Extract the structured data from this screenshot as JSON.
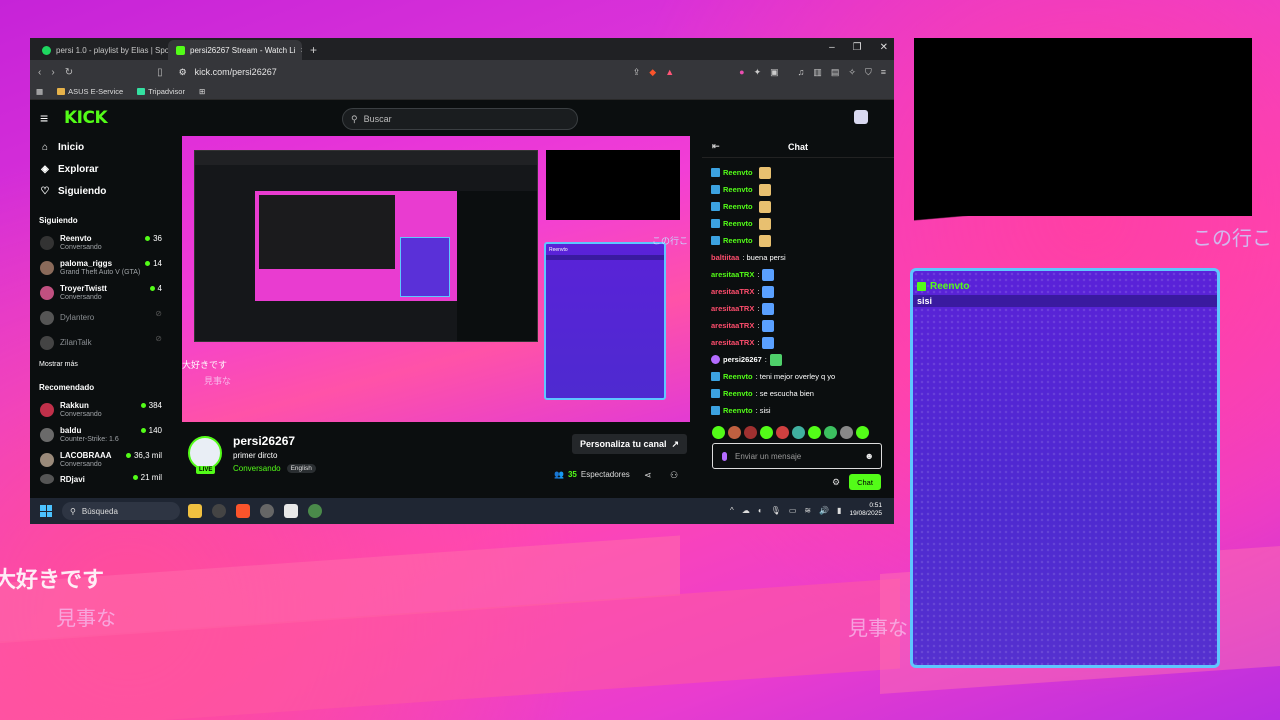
{
  "browser": {
    "tabs": [
      {
        "label": "persi 1.0 - playlist by Elias | Spotify",
        "favicon_color": "#1ed760"
      },
      {
        "label": "persi26267 Stream - Watch Li",
        "favicon_color": "#53fc18"
      }
    ],
    "new_tab": "+",
    "url": "kick.com/persi26267",
    "bookmarks": [
      "ASUS E-Service",
      "Tripadvisor"
    ]
  },
  "kick": {
    "logo": "KICK",
    "search_placeholder": "Buscar",
    "nav": [
      {
        "label": "Inicio",
        "icon": "home-icon"
      },
      {
        "label": "Explorar",
        "icon": "compass-icon"
      },
      {
        "label": "Siguiendo",
        "icon": "heart-icon"
      }
    ],
    "following_title": "Siguiendo",
    "following": [
      {
        "name": "Reenvto",
        "sub": "Conversando",
        "viewers": "36",
        "online": true
      },
      {
        "name": "paloma_riggs",
        "sub": "Grand Theft Auto V (GTA)",
        "viewers": "14",
        "online": true
      },
      {
        "name": "TroyerTwistt",
        "sub": "Conversando",
        "viewers": "4",
        "online": true
      },
      {
        "name": "Dylantero",
        "sub": "",
        "viewers": "",
        "online": false
      },
      {
        "name": "ZilanTalk",
        "sub": "",
        "viewers": "",
        "online": false
      }
    ],
    "show_more": "Mostrar más",
    "recommended_title": "Recomendado",
    "recommended": [
      {
        "name": "Rakkun",
        "sub": "Conversando",
        "viewers": "384"
      },
      {
        "name": "baldu",
        "sub": "Counter-Strike: 1.6",
        "viewers": "140"
      },
      {
        "name": "LACOBRAAA",
        "sub": "Conversando",
        "viewers": "36,3 mil"
      },
      {
        "name": "RDjavi",
        "sub": "",
        "viewers": "21 mil"
      }
    ],
    "stream": {
      "name": "persi26267",
      "title": "primer dircto",
      "category": "Conversando",
      "language": "English",
      "live_badge": "LIVE",
      "customize": "Personaliza tu canal",
      "viewers": "35",
      "viewers_label": "Espectadores"
    },
    "player_overlay": {
      "jp1": "大好きです",
      "jp2": "見事な",
      "jp3": "この行こ",
      "chat_user": "Reenvto"
    },
    "chat": {
      "title": "Chat",
      "messages": [
        {
          "user": "Reenvto",
          "color": "#53fc18",
          "text": "",
          "emote": true
        },
        {
          "user": "Reenvto",
          "color": "#53fc18",
          "text": "",
          "emote": true
        },
        {
          "user": "Reenvto",
          "color": "#53fc18",
          "text": "",
          "emote": true
        },
        {
          "user": "Reenvto",
          "color": "#53fc18",
          "text": "",
          "emote": true
        },
        {
          "user": "Reenvto",
          "color": "#53fc18",
          "text": "",
          "emote": true
        },
        {
          "user": "baltiitaa",
          "color": "#ff4d6d",
          "text": ": buena persi",
          "emote": false
        },
        {
          "user": "aresitaaTRX",
          "color": "#53fc18",
          "text": ":",
          "emote": true
        },
        {
          "user": "aresitaaTRX",
          "color": "#ff4d6d",
          "text": ":",
          "emote": true
        },
        {
          "user": "aresitaaTRX",
          "color": "#ff4d6d",
          "text": ":",
          "emote": true
        },
        {
          "user": "aresitaaTRX",
          "color": "#ff4d6d",
          "text": ":",
          "emote": true
        },
        {
          "user": "aresitaaTRX",
          "color": "#ff4d6d",
          "text": ":",
          "emote": true
        },
        {
          "user": "persi26267",
          "color": "#ffffff",
          "text": ":",
          "emote": true
        },
        {
          "user": "Reenvto",
          "color": "#53fc18",
          "text": ": teni mejor overley q yo",
          "emote": false
        },
        {
          "user": "Reenvto",
          "color": "#53fc18",
          "text": ": se escucha bien",
          "emote": false
        },
        {
          "user": "Reenvto",
          "color": "#53fc18",
          "text": ": sisi",
          "emote": false
        }
      ],
      "input_placeholder": "Enviar un mensaje",
      "send_label": "Chat"
    }
  },
  "taskbar": {
    "search": "Búsqueda",
    "time": "0:51",
    "date": "19/08/2025"
  },
  "overlay": {
    "chat_user": "Reenvto",
    "chat_message": "sisi",
    "jp_left_1": "大好きです",
    "jp_left_2": "見事な",
    "jp_right_1": "この行こ",
    "jp_right_2": "見事な"
  }
}
